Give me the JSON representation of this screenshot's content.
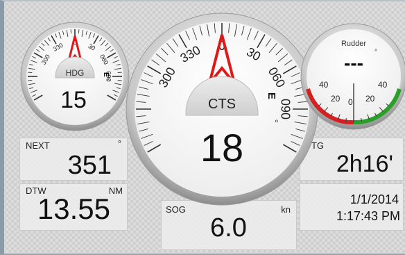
{
  "hdg": {
    "label": "HDG",
    "value": "15",
    "unit": "°",
    "scale": [
      "300",
      "330",
      "0",
      "30",
      "060",
      "090"
    ],
    "east": "E"
  },
  "cts": {
    "label": "CTS",
    "value": "18",
    "unit": "°",
    "scale": [
      "300",
      "330",
      "0",
      "30",
      "060",
      "090"
    ],
    "east": "E"
  },
  "rudder": {
    "title": "Rudder",
    "value": "---",
    "unit": "°",
    "scale": [
      "40",
      "20",
      "0",
      "20",
      "40"
    ]
  },
  "next": {
    "label": "NEXT",
    "unit": "°",
    "value": "351"
  },
  "dtw": {
    "label": "DTW",
    "unit": "NM",
    "value": "13.55"
  },
  "ttg": {
    "label": "TTG",
    "value": "2h16'"
  },
  "sog": {
    "label": "SOG",
    "unit": "kn",
    "value": "6.0"
  },
  "clock": {
    "date": "1/1/2014",
    "time": "1:17:43 PM"
  },
  "colors": {
    "port": "#d42020",
    "starboard": "#2aa02a",
    "needle": "#e01818"
  }
}
